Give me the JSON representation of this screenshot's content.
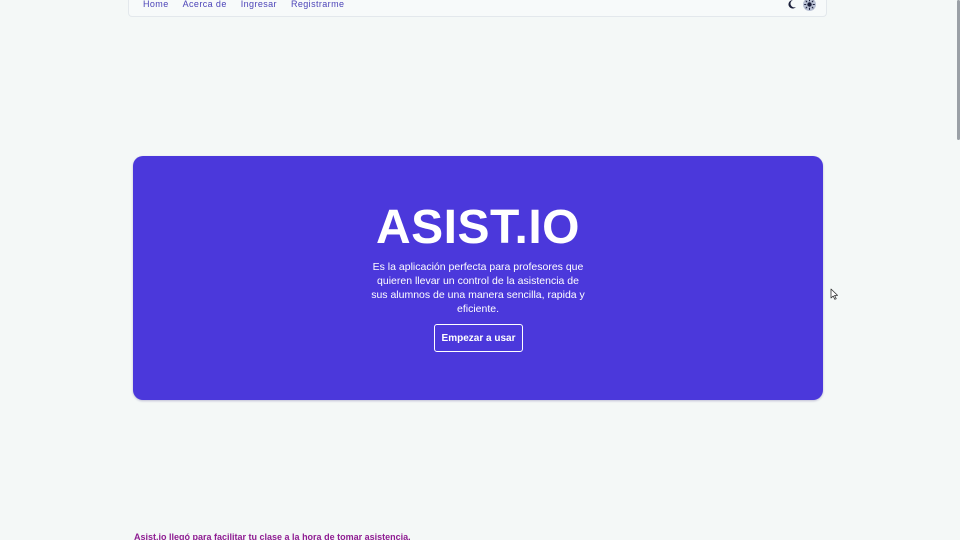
{
  "nav": {
    "links": [
      "Home",
      "Acerca de",
      "Ingresar",
      "Registrarme"
    ],
    "theme_icons": [
      "moon-icon",
      "sun-icon"
    ]
  },
  "hero": {
    "title": "ASIST.IO",
    "description": "Es la aplicación perfecta para profesores que quieren llevar un control de la asistencia de sus alumnos de una manera sencilla, rapida y eficiente.",
    "button_label": "Empezar a usar"
  },
  "footer_text": "Asist.io llegó para facilitar tu clase a la hora de tomar asistencia.",
  "colors": {
    "background": "#f4f8f7",
    "hero_background": "#4b38db",
    "nav_link": "#4c44b8",
    "accent_text": "#8e1d92"
  }
}
